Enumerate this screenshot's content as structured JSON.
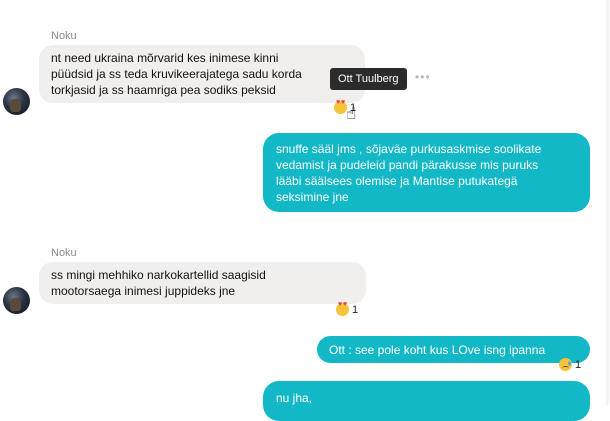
{
  "messages": [
    {
      "sender": "Noku",
      "lines": [
        "nt need ukraina mõrvarid kes inimese kinni",
        "püüdsid ja ss teda kruvikeerajatega sadu korda",
        "torkjasid ja ss haamriga pea sodiks peksid"
      ],
      "reaction": {
        "emoji": "heart-eyes-emoji",
        "count": "1"
      }
    },
    {
      "lines": [
        "snuffe sääl jms , sõjaväe purkusaskmise soolikate",
        "vedamist ja pudeleid pandi pärakusse mis puruks",
        "lääbi säälsees olemise ja Mantise putukategä",
        "seksimine jne"
      ]
    },
    {
      "sender": "Noku",
      "lines": [
        "ss mingi mehhiko narkokartellid saagisid",
        "mootorsaega inimesi juppideks jne"
      ],
      "reaction": {
        "emoji": "heart-eyes-emoji",
        "count": "1"
      }
    },
    {
      "lines": [
        "Ott : see pole koht kus LOve isng ipanna"
      ],
      "reaction": {
        "emoji": "sad-tear-emoji",
        "count": "1"
      }
    },
    {
      "lines": [
        "nu jha,"
      ]
    }
  ],
  "tooltip": {
    "text": "Ott Tuulberg"
  },
  "more_icon": {
    "glyph": "•••"
  },
  "cursor_icon": {
    "glyph": "☝"
  }
}
